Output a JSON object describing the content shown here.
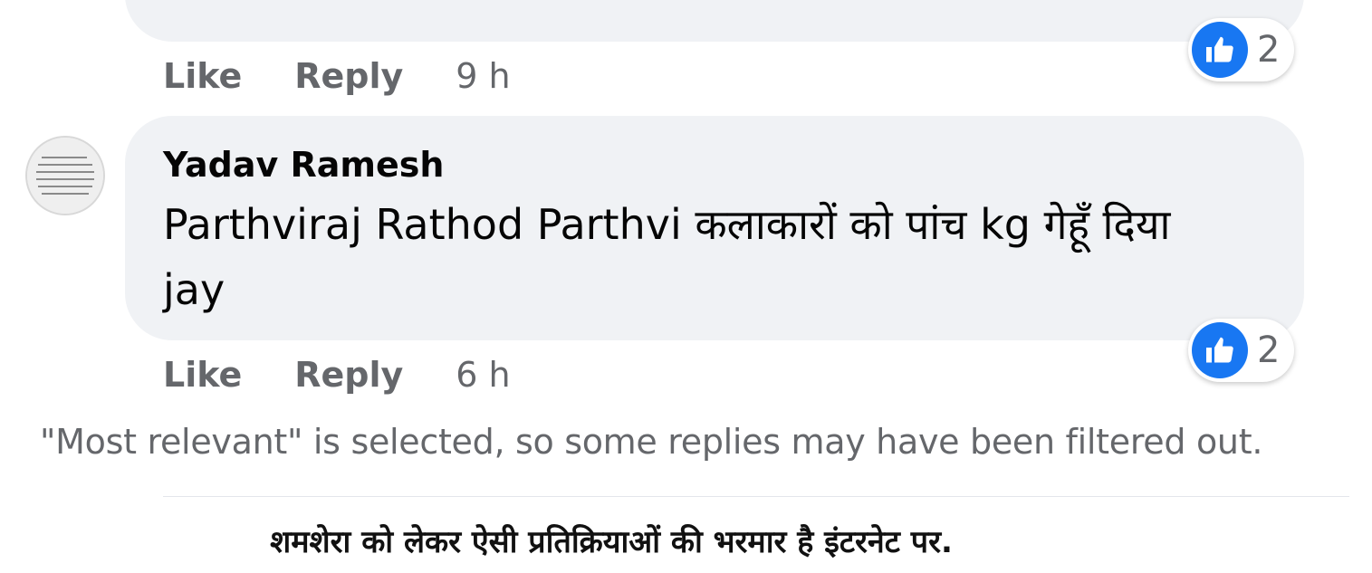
{
  "previous_comment": {
    "actions": {
      "like_label": "Like",
      "reply_label": "Reply",
      "time": "9 h"
    },
    "reactions": {
      "icon": "thumbs-up-icon",
      "count": "2"
    }
  },
  "comment": {
    "author": "Yadav Ramesh",
    "text": "Parthviraj Rathod Parthvi कलाकारों को पांच kg गेहूँ दिया jay",
    "actions": {
      "like_label": "Like",
      "reply_label": "Reply",
      "time": "6 h"
    },
    "reactions": {
      "icon": "thumbs-up-icon",
      "count": "2"
    }
  },
  "filter_notice": "\"Most relevant\" is selected, so some replies may have been filtered out.",
  "caption": "शमशेरा को लेकर ऐसी प्रतिक्रियाओं की भरमार है इंटरनेट पर.",
  "colors": {
    "like_blue": "#1877f2",
    "bubble_bg": "#f0f2f5",
    "secondary_text": "#65676b"
  }
}
